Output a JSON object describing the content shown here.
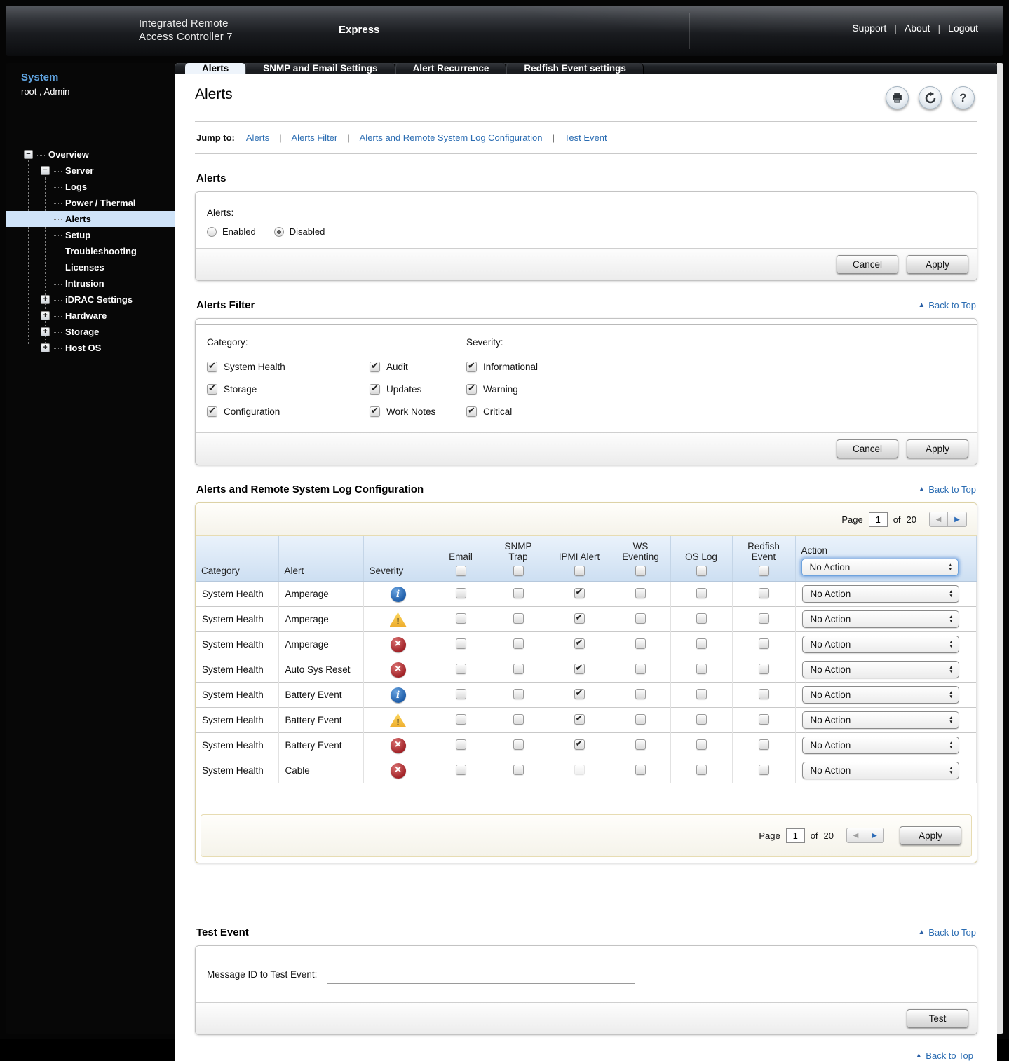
{
  "header": {
    "product_name_line1": "Integrated Remote",
    "product_name_line2": "Access Controller 7",
    "edition": "Express",
    "links": [
      {
        "label": "Support"
      },
      {
        "label": "About"
      },
      {
        "label": "Logout"
      }
    ]
  },
  "sidebar": {
    "system_label": "System",
    "user_info": "root , Admin",
    "tree": [
      {
        "label": "Overview",
        "level": "l0",
        "toggle": "minus",
        "selected": false
      },
      {
        "label": "Server",
        "level": "l1",
        "toggle": "minus",
        "selected": false
      },
      {
        "label": "Logs",
        "level": "l2",
        "selected": false
      },
      {
        "label": "Power / Thermal",
        "level": "l2",
        "selected": false
      },
      {
        "label": "Alerts",
        "level": "l2",
        "selected": true
      },
      {
        "label": "Setup",
        "level": "l2",
        "selected": false
      },
      {
        "label": "Troubleshooting",
        "level": "l2",
        "selected": false
      },
      {
        "label": "Licenses",
        "level": "l2",
        "selected": false
      },
      {
        "label": "Intrusion",
        "level": "l2",
        "selected": false
      },
      {
        "label": "iDRAC Settings",
        "level": "l1",
        "toggle": "plus",
        "selected": false
      },
      {
        "label": "Hardware",
        "level": "l1",
        "toggle": "plus",
        "selected": false
      },
      {
        "label": "Storage",
        "level": "l1",
        "toggle": "plus",
        "selected": false
      },
      {
        "label": "Host OS",
        "level": "l1",
        "toggle": "plus",
        "selected": false
      }
    ]
  },
  "tabs": [
    {
      "label": "Alerts",
      "active": true
    },
    {
      "label": "SNMP and Email Settings",
      "active": false
    },
    {
      "label": "Alert Recurrence",
      "active": false
    },
    {
      "label": "Redfish Event settings",
      "active": false
    }
  ],
  "page": {
    "title": "Alerts",
    "jump_to_label": "Jump to:",
    "jump_links": [
      {
        "label": "Alerts"
      },
      {
        "label": "Alerts Filter"
      },
      {
        "label": "Alerts and Remote System Log Configuration"
      },
      {
        "label": "Test Event"
      }
    ],
    "icons": {
      "print": "print-icon",
      "refresh": "refresh-icon",
      "help": "help-icon"
    }
  },
  "alerts_section": {
    "heading": "Alerts",
    "field_label": "Alerts:",
    "options": [
      {
        "label": "Enabled",
        "selected": false
      },
      {
        "label": "Disabled",
        "selected": true
      }
    ],
    "cancel_label": "Cancel",
    "apply_label": "Apply"
  },
  "alerts_filter": {
    "heading": "Alerts Filter",
    "back_to_top": "Back to Top",
    "category_label": "Category:",
    "severity_label": "Severity:",
    "category_col1": [
      {
        "label": "System Health",
        "checked": true
      },
      {
        "label": "Storage",
        "checked": true
      },
      {
        "label": "Configuration",
        "checked": true
      }
    ],
    "category_col2": [
      {
        "label": "Audit",
        "checked": true
      },
      {
        "label": "Updates",
        "checked": true
      },
      {
        "label": "Work Notes",
        "checked": true
      }
    ],
    "severity_col": [
      {
        "label": "Informational",
        "checked": true
      },
      {
        "label": "Warning",
        "checked": true
      },
      {
        "label": "Critical",
        "checked": true
      }
    ],
    "cancel_label": "Cancel",
    "apply_label": "Apply"
  },
  "alert_table": {
    "heading": "Alerts and Remote System Log Configuration",
    "back_to_top": "Back to Top",
    "page_label": "Page",
    "page_current": "1",
    "of_label": "of",
    "page_total": "20",
    "columns": {
      "category": "Category",
      "alert": "Alert",
      "severity": "Severity",
      "email": "Email",
      "snmp": "SNMP Trap",
      "ipmi": "IPMI Alert",
      "ws": "WS Eventing",
      "os": "OS Log",
      "redfish": "Redfish Event",
      "action": "Action"
    },
    "header_action_value": "No Action",
    "rows": [
      {
        "category": "System Health",
        "alert": "Amperage",
        "severity": "info",
        "email": false,
        "snmp": false,
        "ipmi_state": "checked",
        "ws": false,
        "os": false,
        "redfish": false,
        "action": "No Action"
      },
      {
        "category": "System Health",
        "alert": "Amperage",
        "severity": "warning",
        "email": false,
        "snmp": false,
        "ipmi_state": "checked",
        "ws": false,
        "os": false,
        "redfish": false,
        "action": "No Action"
      },
      {
        "category": "System Health",
        "alert": "Amperage",
        "severity": "critical",
        "email": false,
        "snmp": false,
        "ipmi_state": "checked",
        "ws": false,
        "os": false,
        "redfish": false,
        "action": "No Action"
      },
      {
        "category": "System Health",
        "alert": "Auto Sys Reset",
        "severity": "critical",
        "email": false,
        "snmp": false,
        "ipmi_state": "checked",
        "ws": false,
        "os": false,
        "redfish": false,
        "action": "No Action"
      },
      {
        "category": "System Health",
        "alert": "Battery Event",
        "severity": "info",
        "email": false,
        "snmp": false,
        "ipmi_state": "checked",
        "ws": false,
        "os": false,
        "redfish": false,
        "action": "No Action"
      },
      {
        "category": "System Health",
        "alert": "Battery Event",
        "severity": "warning",
        "email": false,
        "snmp": false,
        "ipmi_state": "checked",
        "ws": false,
        "os": false,
        "redfish": false,
        "action": "No Action"
      },
      {
        "category": "System Health",
        "alert": "Battery Event",
        "severity": "critical",
        "email": false,
        "snmp": false,
        "ipmi_state": "checked",
        "ws": false,
        "os": false,
        "redfish": false,
        "action": "No Action"
      },
      {
        "category": "System Health",
        "alert": "Cable",
        "severity": "critical",
        "email": false,
        "snmp": false,
        "ipmi_state": "disabled",
        "ws": false,
        "os": false,
        "redfish": false,
        "action": "No Action"
      }
    ],
    "apply_label": "Apply"
  },
  "test_event": {
    "heading": "Test Event",
    "back_to_top": "Back to Top",
    "field_label": "Message ID to Test Event:",
    "input_value": "",
    "test_label": "Test"
  },
  "footer": {
    "back_to_top": "Back to Top"
  }
}
